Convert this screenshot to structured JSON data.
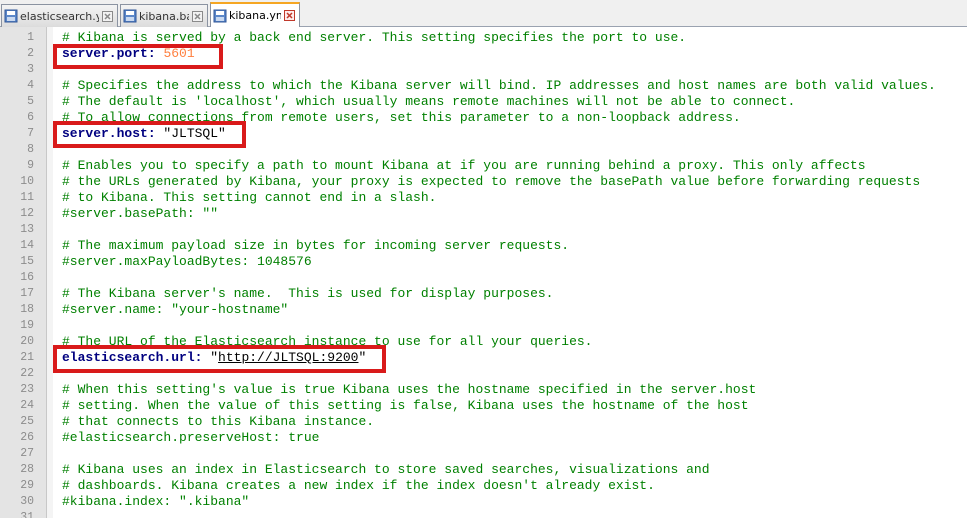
{
  "tabs": [
    {
      "label": "elasticsearch.yml",
      "active": false
    },
    {
      "label": "kibana.bat",
      "active": false
    },
    {
      "label": "kibana.yml",
      "active": true
    }
  ],
  "colors": {
    "comment": "#008000",
    "key": "#000080",
    "number": "#ff8040",
    "highlight": "#d91a1a",
    "active_tab_accent": "#f5a623"
  },
  "lines": [
    {
      "n": "1",
      "segments": [
        {
          "t": "# Kibana is served by a back end server. This setting specifies the port to use.",
          "c": "comment"
        }
      ]
    },
    {
      "n": "2",
      "segments": [
        {
          "t": "server.port:",
          "c": "key"
        },
        {
          "t": " ",
          "c": "str"
        },
        {
          "t": "5601",
          "c": "num"
        }
      ]
    },
    {
      "n": "3",
      "segments": []
    },
    {
      "n": "4",
      "segments": [
        {
          "t": "# Specifies the address to which the Kibana server will bind. IP addresses and host names are both valid values.",
          "c": "comment"
        }
      ]
    },
    {
      "n": "5",
      "segments": [
        {
          "t": "# The default is 'localhost', which usually means remote machines will not be able to connect.",
          "c": "comment"
        }
      ]
    },
    {
      "n": "6",
      "segments": [
        {
          "t": "# To allow connections from remote users, set this parameter to a non-loopback address.",
          "c": "comment"
        }
      ]
    },
    {
      "n": "7",
      "segments": [
        {
          "t": "server.host:",
          "c": "key"
        },
        {
          "t": " \"JLTSQL\"",
          "c": "str"
        }
      ]
    },
    {
      "n": "8",
      "segments": []
    },
    {
      "n": "9",
      "segments": [
        {
          "t": "# Enables you to specify a path to mount Kibana at if you are running behind a proxy. This only affects",
          "c": "comment"
        }
      ]
    },
    {
      "n": "10",
      "segments": [
        {
          "t": "# the URLs generated by Kibana, your proxy is expected to remove the basePath value before forwarding requests",
          "c": "comment"
        }
      ]
    },
    {
      "n": "11",
      "segments": [
        {
          "t": "# to Kibana. This setting cannot end in a slash.",
          "c": "comment"
        }
      ]
    },
    {
      "n": "12",
      "segments": [
        {
          "t": "#server.basePath: \"\"",
          "c": "comment"
        }
      ]
    },
    {
      "n": "13",
      "segments": []
    },
    {
      "n": "14",
      "segments": [
        {
          "t": "# The maximum payload size in bytes for incoming server requests.",
          "c": "comment"
        }
      ]
    },
    {
      "n": "15",
      "segments": [
        {
          "t": "#server.maxPayloadBytes: 1048576",
          "c": "comment"
        }
      ]
    },
    {
      "n": "16",
      "segments": []
    },
    {
      "n": "17",
      "segments": [
        {
          "t": "# The Kibana server's name.  This is used for display purposes.",
          "c": "comment"
        }
      ]
    },
    {
      "n": "18",
      "segments": [
        {
          "t": "#server.name: \"your-hostname\"",
          "c": "comment"
        }
      ]
    },
    {
      "n": "19",
      "segments": []
    },
    {
      "n": "20",
      "segments": [
        {
          "t": "# The URL of the Elasticsearch instance to use for all your queries.",
          "c": "comment"
        }
      ]
    },
    {
      "n": "21",
      "segments": [
        {
          "t": "elasticsearch.url:",
          "c": "key"
        },
        {
          "t": " \"",
          "c": "str"
        },
        {
          "t": "http://JLTSQL:9200",
          "c": "url"
        },
        {
          "t": "\"",
          "c": "str"
        }
      ]
    },
    {
      "n": "22",
      "segments": []
    },
    {
      "n": "23",
      "segments": [
        {
          "t": "# When this setting's value is true Kibana uses the hostname specified in the server.host",
          "c": "comment"
        }
      ]
    },
    {
      "n": "24",
      "segments": [
        {
          "t": "# setting. When the value of this setting is false, Kibana uses the hostname of the host",
          "c": "comment"
        }
      ]
    },
    {
      "n": "25",
      "segments": [
        {
          "t": "# that connects to this Kibana instance.",
          "c": "comment"
        }
      ]
    },
    {
      "n": "26",
      "segments": [
        {
          "t": "#elasticsearch.preserveHost: true",
          "c": "comment"
        }
      ]
    },
    {
      "n": "27",
      "segments": []
    },
    {
      "n": "28",
      "segments": [
        {
          "t": "# Kibana uses an index in Elasticsearch to store saved searches, visualizations and",
          "c": "comment"
        }
      ]
    },
    {
      "n": "29",
      "segments": [
        {
          "t": "# dashboards. Kibana creates a new index if the index doesn't already exist.",
          "c": "comment"
        }
      ]
    },
    {
      "n": "30",
      "segments": [
        {
          "t": "#kibana.index: \".kibana\"",
          "c": "comment"
        }
      ]
    },
    {
      "n": "31",
      "segments": []
    }
  ]
}
